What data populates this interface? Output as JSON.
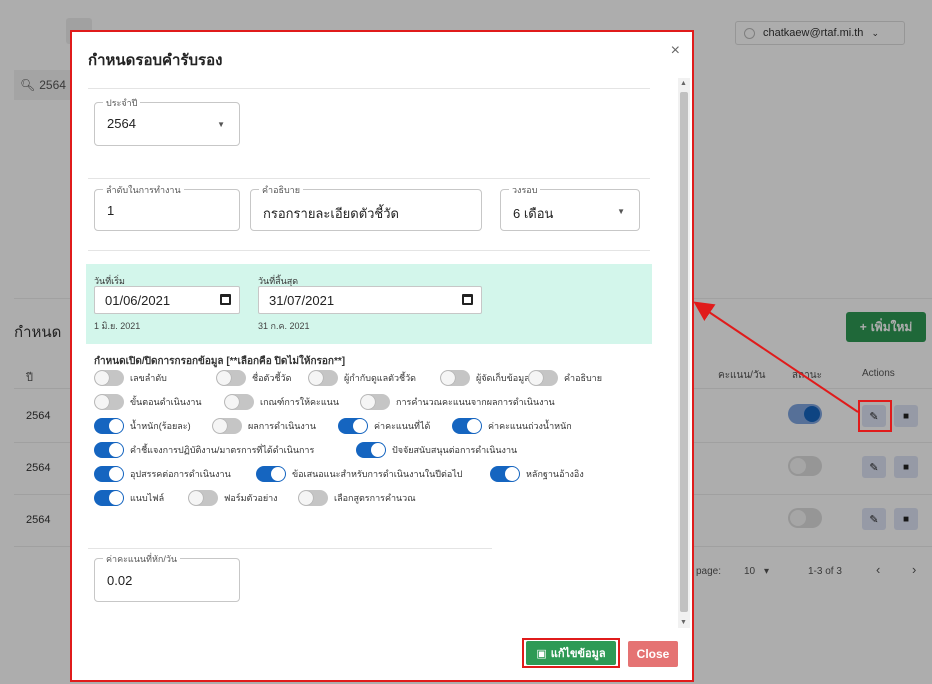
{
  "background": {
    "user_email": "chatkaew@rtaf.mi.th",
    "search_text": "2564",
    "card_title": "กำหนด",
    "add_button": "เพิ่มใหม่",
    "columns": {
      "year": "ปี",
      "score": "คะแนน/วัน",
      "status": "สถานะ",
      "actions": "Actions"
    },
    "rows": [
      {
        "year": "2564",
        "active": true
      },
      {
        "year": "2564",
        "active": false
      },
      {
        "year": "2564",
        "active": false
      }
    ],
    "pager": {
      "label": "page:",
      "per_page": "10",
      "range": "1-3 of 3"
    }
  },
  "dialog": {
    "title": "กำหนดรอบคำรับรอง",
    "year_field": {
      "label": "ประจำปี",
      "value": "2564"
    },
    "order_field": {
      "label": "ลำดับในการทำงาน",
      "value": "1"
    },
    "description_field": {
      "label": "คำอธิบาย",
      "value": "กรอกรายละเอียดตัวชี้วัด"
    },
    "cycle_field": {
      "label": "วงรอบ",
      "value": "6 เดือน"
    },
    "start_date": {
      "label": "วันที่เริ่ม",
      "value": "01/06/2021",
      "display": "1 มิ.ย. 2021"
    },
    "end_date": {
      "label": "วันที่สิ้นสุด",
      "value": "31/07/2021",
      "display": "31 ก.ค. 2021"
    },
    "toggles_title": "กำหนดเปิด/ปิดการกรอกข้อมูล [**เลือกคือ ปิดไม่ให้กรอก**]",
    "toggles": [
      {
        "label": "เลขลำดับ",
        "on": false
      },
      {
        "label": "ชื่อตัวชี้วัด",
        "on": false
      },
      {
        "label": "ผู้กำกับดูแลตัวชี้วัด",
        "on": false
      },
      {
        "label": "ผู้จัดเก็บข้อมูล",
        "on": false
      },
      {
        "label": "คำอธิบาย",
        "on": false
      },
      {
        "label": "ขั้นตอนดำเนินงาน",
        "on": false
      },
      {
        "label": "เกณฑ์การให้คะแนน",
        "on": false
      },
      {
        "label": "การคำนวณคะแนนจากผลการดำเนินงาน",
        "on": false
      },
      {
        "label": "น้ำหนัก(ร้อยละ)",
        "on": true
      },
      {
        "label": "ผลการดำเนินงาน",
        "on": false
      },
      {
        "label": "ค่าคะแนนที่ได้",
        "on": true
      },
      {
        "label": "ค่าคะแนนถ่วงน้ำหนัก",
        "on": true
      },
      {
        "label": "คำชี้แจงการปฏิบัติงาน/มาตรการที่ได้ดำเนินการ",
        "on": true
      },
      {
        "label": "ปัจจัยสนับสนุนต่อการดำเนินงาน",
        "on": true
      },
      {
        "label": "อุปสรรคต่อการดำเนินงาน",
        "on": true
      },
      {
        "label": "ข้อเสนอแนะสำหรับการดำเนินงานในปีต่อไป",
        "on": true
      },
      {
        "label": "หลักฐานอ้างอิง",
        "on": true
      },
      {
        "label": "แนบไฟล์",
        "on": true
      },
      {
        "label": "ฟอร์มตัวอย่าง",
        "on": false
      },
      {
        "label": "เลือกสูตรการคำนวณ",
        "on": false
      }
    ],
    "score_per_day": {
      "label": "ค่าคะแนนที่หัก/วัน",
      "value": "0.02"
    },
    "save_button": "แก้ไขข้อมูล",
    "close_button": "Close"
  },
  "colors": {
    "accent_red": "#e01b1b",
    "save_green": "#2e9a55",
    "toggle_blue": "#1565c0",
    "date_bg": "#d3f6eb",
    "close_red": "#e57373"
  }
}
